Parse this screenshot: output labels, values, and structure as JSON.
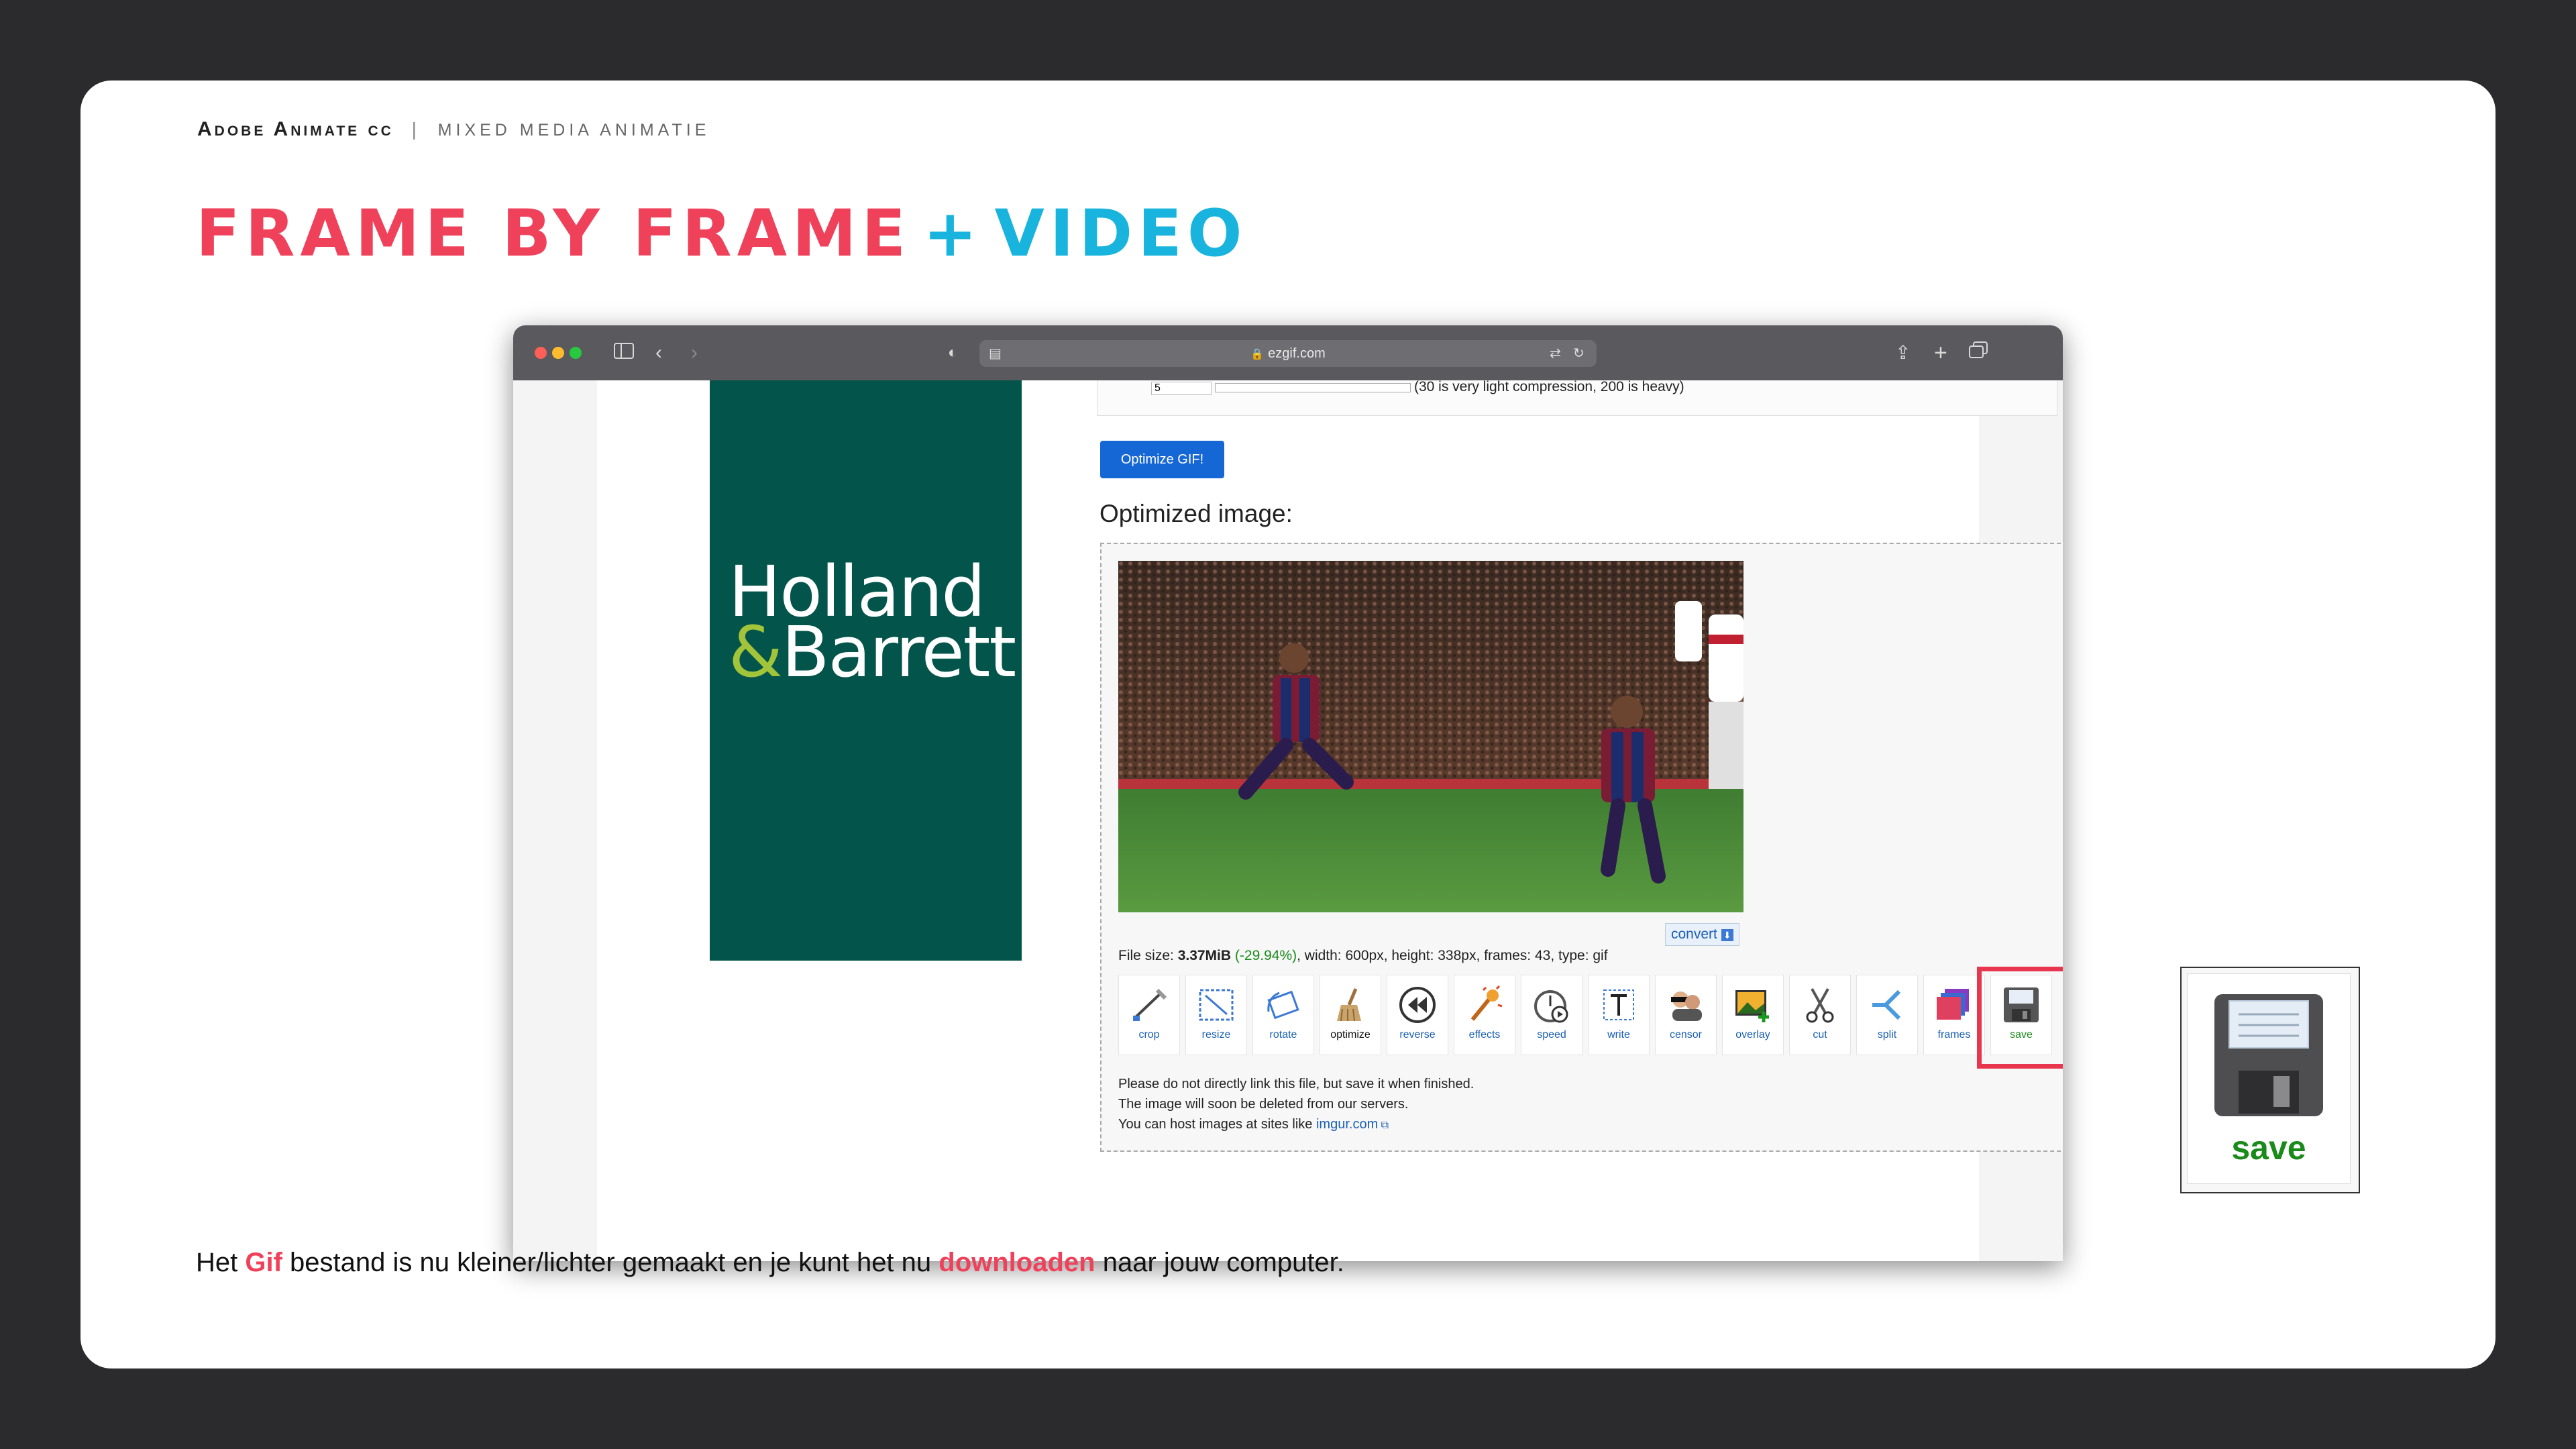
{
  "header": {
    "brand": "Adobe Animate cc",
    "separator": "|",
    "course": "MIXED MEDIA ANIMATIE"
  },
  "title": {
    "part1": "FRAME BY FRAME",
    "plus": "+",
    "part2": "VIDEO"
  },
  "browser": {
    "url": "ezgif.com",
    "lock_icon": "lock-icon",
    "form": {
      "value": "5",
      "hint": "(30 is very light compression, 200 is heavy)"
    },
    "optimize_button": "Optimize GIF!",
    "optimized_title": "Optimized image:",
    "banner": {
      "line1": "Holland",
      "amp": "&",
      "line2": "Barrett"
    },
    "convert": "convert",
    "fileinfo": {
      "prefix": "File size: ",
      "size": "3.37MiB",
      "percent": "(-29.94%)",
      "rest": ", width: 600px, height: 338px, frames: 43, type: gif"
    },
    "tools": [
      {
        "label": "crop",
        "icon": "crop-icon"
      },
      {
        "label": "resize",
        "icon": "resize-icon"
      },
      {
        "label": "rotate",
        "icon": "rotate-icon"
      },
      {
        "label": "optimize",
        "icon": "broom-icon"
      },
      {
        "label": "reverse",
        "icon": "rewind-icon"
      },
      {
        "label": "effects",
        "icon": "magic-wand-icon"
      },
      {
        "label": "speed",
        "icon": "stopwatch-icon"
      },
      {
        "label": "write",
        "icon": "text-icon"
      },
      {
        "label": "censor",
        "icon": "censor-icon"
      },
      {
        "label": "overlay",
        "icon": "image-add-icon"
      },
      {
        "label": "cut",
        "icon": "scissors-icon"
      },
      {
        "label": "split",
        "icon": "split-icon"
      },
      {
        "label": "frames",
        "icon": "frames-icon"
      },
      {
        "label": "save",
        "icon": "floppy-disk-icon"
      }
    ],
    "notice": {
      "line1": "Please do not directly link this file, but save it when finished.",
      "line2": "The image will soon be deleted from our servers.",
      "line3_prefix": "You can host images at sites like ",
      "link": "imgur.com"
    }
  },
  "save_zoom": {
    "label": "save",
    "icon": "floppy-disk-icon"
  },
  "caption": {
    "t1": "Het ",
    "h1": "Gif",
    "t2": " bestand is nu kleiner/lichter gemaakt en je kunt het nu ",
    "h2": "downloaden",
    "t3": " naar jouw computer."
  },
  "colors": {
    "accent_red": "#f0415a",
    "accent_blue": "#19b4dd",
    "banner_green": "#03544a",
    "highlight": "#e8364e"
  }
}
